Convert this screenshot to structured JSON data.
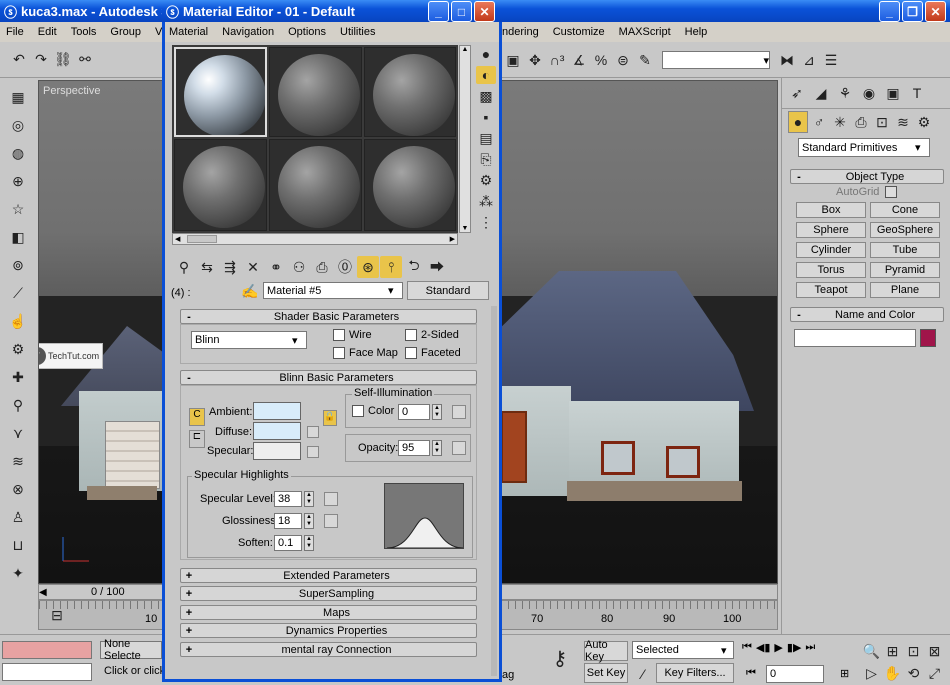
{
  "main_window": {
    "title": "kuca3.max - Autodesk 3ds",
    "menu": [
      "File",
      "Edit",
      "Tools",
      "Group",
      "Views"
    ],
    "menu_right": [
      "ndering",
      "Customize",
      "MAXScript",
      "Help"
    ]
  },
  "viewport": {
    "label": "Perspective",
    "watermark": "TechTut.com",
    "timeline_frame": "0 / 100"
  },
  "timeline_ticks_left": [
    "10"
  ],
  "timeline_ticks_right": [
    "70",
    "80",
    "90",
    "100"
  ],
  "status": {
    "selection": "None Selecte",
    "prompt": "Click or click",
    "partial": "ag",
    "auto_key": "Auto Key",
    "set_key": "Set Key",
    "selected_value": "Selected",
    "key_filters": "Key Filters...",
    "frame_value": "0"
  },
  "command_panel": {
    "dropdown": "Standard Primitives",
    "object_type": "Object Type",
    "autogrid": "AutoGrid",
    "buttons": [
      "Box",
      "Cone",
      "Sphere",
      "GeoSphere",
      "Cylinder",
      "Tube",
      "Torus",
      "Pyramid",
      "Teapot",
      "Plane"
    ],
    "name_and_color": "Name and Color",
    "name_value": "",
    "object_color": "#a0154a"
  },
  "material_editor": {
    "title": "Material Editor - 01 - Default",
    "menu": [
      "Material",
      "Navigation",
      "Options",
      "Utilities"
    ],
    "slot_index": "(4) :",
    "material_name": "Material #5",
    "material_type": "Standard",
    "shader_rollout": "Shader Basic Parameters",
    "shader": "Blinn",
    "wire": "Wire",
    "two_sided": "2-Sided",
    "face_map": "Face Map",
    "faceted": "Faceted",
    "blinn_rollout": "Blinn Basic Parameters",
    "self_illumination": "Self-Illumination",
    "color_label": "Color",
    "self_illum_value": "0",
    "ambient": "Ambient:",
    "diffuse": "Diffuse:",
    "specular": "Specular:",
    "ambient_color": "#d8ecfa",
    "diffuse_color": "#d8ecfa",
    "specular_color": "#eeeeee",
    "opacity_label": "Opacity:",
    "opacity": "95",
    "specular_highlights": "Specular Highlights",
    "specular_level_label": "Specular Level:",
    "specular_level": "38",
    "glossiness_label": "Glossiness:",
    "glossiness": "18",
    "soften_label": "Soften:",
    "soften": "0.1",
    "collapsed_rollouts": [
      "Extended Parameters",
      "SuperSampling",
      "Maps",
      "Dynamics Properties",
      "mental ray Connection"
    ]
  }
}
